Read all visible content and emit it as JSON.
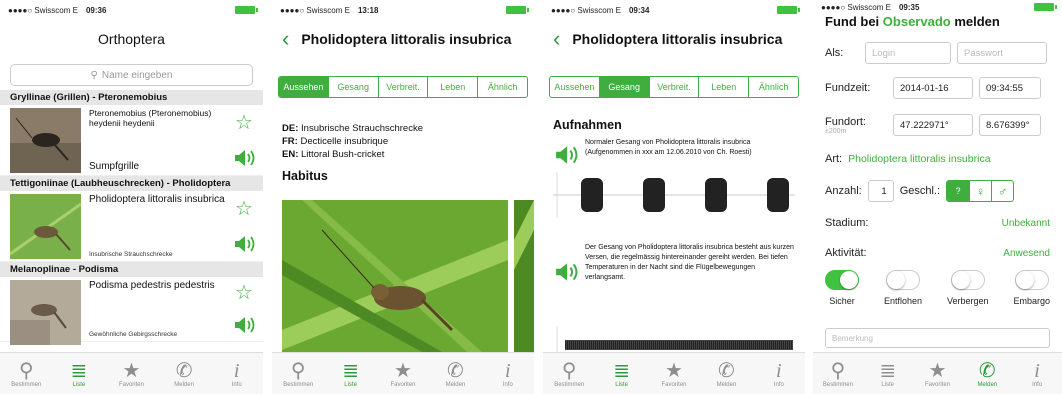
{
  "colors": {
    "accent": "#3fae3f",
    "link": "#2a9a3c"
  },
  "s1": {
    "status": {
      "carrier": "●●●●○ Swisscom  E",
      "time": "09:36"
    },
    "title": "Orthoptera",
    "search_placeholder": "Name eingeben",
    "groups": [
      {
        "header": "Gryllinae (Grillen) - Pteronemobius",
        "name": "Pteronemobius (Pteronemobius) heydenii heydenii",
        "common": "Sumpfgrille"
      },
      {
        "header": "Tettigoniinae (Laubheuschrecken) - Pholidoptera",
        "name": "Pholidoptera littoralis insubrica",
        "common": "Insubrische Strauchschrecke"
      },
      {
        "header": "Melanoplinae - Podisma",
        "name": "Podisma pedestris pedestris",
        "common": "Gewöhnliche Gebirgsschrecke"
      }
    ]
  },
  "tabs": [
    "Bestimmen",
    "Liste",
    "Favoriten",
    "Melden",
    "Info"
  ],
  "s2": {
    "status": {
      "carrier": "●●●●○ Swisscom  E",
      "time": "13:18"
    },
    "title": "Pholidoptera littoralis insubrica",
    "segments": [
      "Aussehen",
      "Gesang",
      "Verbreit.",
      "Leben",
      "Ähnlich"
    ],
    "names": [
      {
        "lang": "DE:",
        "text": "Insubrische Strauchschrecke"
      },
      {
        "lang": "FR:",
        "text": "Decticelle insubrique"
      },
      {
        "lang": "EN:",
        "text": "Littoral Bush-cricket"
      }
    ],
    "section": "Habitus"
  },
  "s3": {
    "status": {
      "carrier": "●●●●○ Swisscom  E",
      "time": "09:34"
    },
    "title": "Pholidoptera littoralis insubrica",
    "segments": [
      "Aussehen",
      "Gesang",
      "Verbreit.",
      "Leben",
      "Ähnlich"
    ],
    "section": "Aufnahmen",
    "rec1": "Normaler Gesang von Pholidoptera littoralis insubrica (Aufgenommen in xxx am 12.06.2010 von Ch. Roesti)",
    "rec2": "Der Gesang von Pholidoptera littoralis insubrica besteht aus kurzen Versen, die regelmässig hintereinander gereiht werden. Bei tiefen Temperaturen in der Nacht sind die Flügelbewegungen verlangsamt."
  },
  "s4": {
    "status": {
      "carrier": "●●●●○ Swisscom  E",
      "time": "09:35"
    },
    "title_pre": "Fund bei ",
    "title_brand": "Observado",
    "title_post": " melden",
    "als": "Als:",
    "login_ph": "Login",
    "pass_ph": "Passwort",
    "fundzeit": "Fundzeit:",
    "date": "2014-01-16",
    "time": "09:34:55",
    "fundort": "Fundort:",
    "accuracy": "±200m",
    "lat": "47.222971°",
    "lon": "8.676399°",
    "art_label": "Art:",
    "art": "Pholidoptera littoralis insubrica",
    "anzahl": "Anzahl:",
    "count": "1",
    "geschl": "Geschl.:",
    "stadium": "Stadium:",
    "stadium_val": "Unbekannt",
    "aktivitaet": "Aktivität:",
    "aktivitaet_val": "Anwesend",
    "toggles": [
      {
        "label": "Sicher",
        "on": true
      },
      {
        "label": "Entflohen",
        "on": false
      },
      {
        "label": "Verbergen",
        "on": false
      },
      {
        "label": "Embargo",
        "on": false
      }
    ],
    "remark_ph": "Bemerkung"
  }
}
